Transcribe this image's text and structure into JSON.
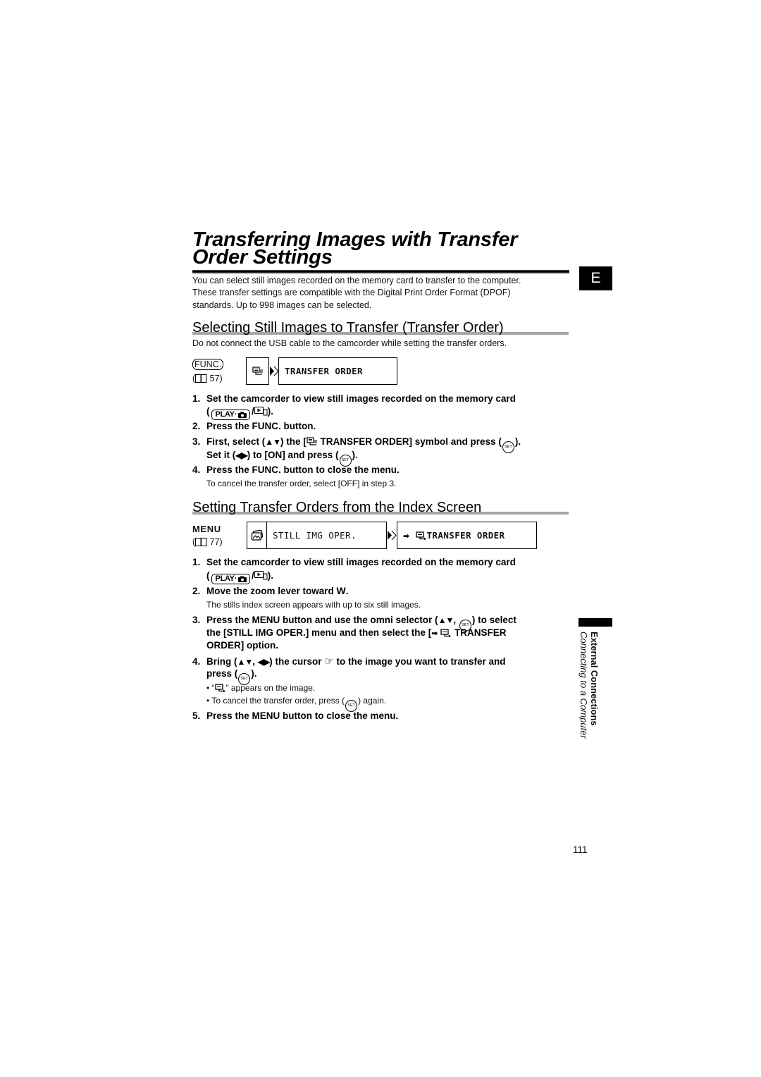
{
  "header": {
    "title_line1": "Transferring Images with Transfer",
    "title_line2": "Order Settings",
    "language_tab": "E"
  },
  "intro": {
    "lines": [
      "You can select still images recorded on the memory card to transfer to the computer.",
      "These transfer settings are compatible with the Digital Print Order Format (DPOF)",
      "standards. Up to 998 images can be selected."
    ]
  },
  "glyphs": {
    "up_down": "▲▼",
    "left_right": "◀▶",
    "set_button": "SET",
    "right_arrow": "➡",
    "cursor": "☞",
    "bullet": "•"
  },
  "section1": {
    "heading": "Selecting Still Images to Transfer (Transfer Order)",
    "note": "Do not connect the USB cable to the camcorder while setting the transfer orders.",
    "access": {
      "button": "FUNC.",
      "ref_prefix": "(",
      "ref_suffix": " 57)"
    },
    "menu_item": "TRANSFER ORDER",
    "steps": [
      {
        "num": "1.",
        "line1": "Set the camcorder to view still images recorded on the memory card",
        "open": "(",
        "mode": "PLAY·",
        "sep": "/",
        "close": ")."
      },
      {
        "num": "2.",
        "line1": "Press the FUNC. button."
      },
      {
        "num": "3.",
        "p1": "First, select (",
        "p2": ") the [",
        "p3": " TRANSFER ORDER] symbol and press (",
        "p4": ").",
        "l2p1": "Set it (",
        "l2p2": ") to [ON] and press (",
        "l2p3": ")."
      },
      {
        "num": "4.",
        "line1": "Press the FUNC. button to close the menu.",
        "note": "To cancel the transfer order, select [OFF] in step 3."
      }
    ]
  },
  "section2": {
    "heading": "Setting Transfer Orders from the Index Screen",
    "access": {
      "button": "MENU",
      "ref_prefix": "(",
      "ref_suffix": " 77)"
    },
    "menu": "STILL IMG OPER.",
    "menu_item": "TRANSFER ORDER",
    "steps": [
      {
        "num": "1.",
        "line1": "Set the camcorder to view still images recorded on the memory card",
        "open": "(",
        "mode": "PLAY·",
        "sep": "/",
        "close": ")."
      },
      {
        "num": "2.",
        "line1": "Move the zoom lever toward ",
        "emph": "W",
        "end": ".",
        "note": "The stills index screen appears with up to six still images."
      },
      {
        "num": "3.",
        "p1": "Press the MENU button and use the omni selector (",
        "p2": ", ",
        "p3": ") to select",
        "l2p1": "the [STILL IMG OPER.] menu and then select the [",
        "l2p2": " TRANSFER",
        "l3": "ORDER] option."
      },
      {
        "num": "4.",
        "p1": "Bring (",
        "p2": ", ",
        "p3": ") the cursor ",
        "p4": " to the image you want to transfer and",
        "l2p1": "press (",
        "l2p2": ").",
        "bullets": [
          {
            "pre": " “",
            "post": "” appears on the image."
          },
          {
            "pre": " To cancel the transfer order, press (",
            "post": ") again."
          }
        ]
      },
      {
        "num": "5.",
        "line1": "Press the MENU button to close the menu."
      }
    ]
  },
  "side_tab": {
    "chapter": "External Connections",
    "section": "Connecting to a Computer"
  },
  "page_number": "111"
}
